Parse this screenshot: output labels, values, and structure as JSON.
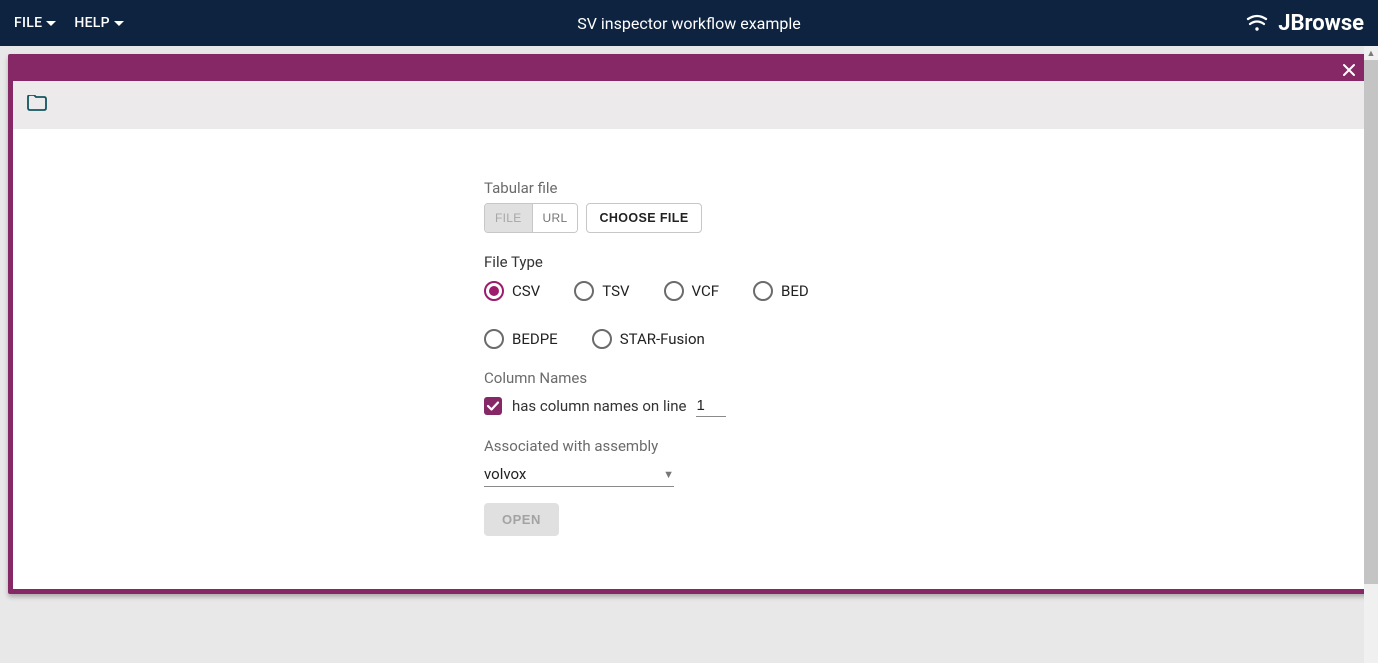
{
  "top": {
    "menu": {
      "file": "FILE",
      "help": "HELP"
    },
    "title": "SV inspector workflow example",
    "brand": "JBrowse"
  },
  "form": {
    "tabular_label": "Tabular file",
    "source_toggle": {
      "file": "FILE",
      "url": "URL"
    },
    "choose_file": "CHOOSE FILE",
    "file_type_label": "File Type",
    "file_types": {
      "csv": "CSV",
      "tsv": "TSV",
      "vcf": "VCF",
      "bed": "BED",
      "bedpe": "BEDPE",
      "starfusion": "STAR-Fusion"
    },
    "column_names_label": "Column Names",
    "has_column_names": "has column names on line",
    "line_number": "1",
    "assembly_label": "Associated with assembly",
    "assembly_value": "volvox",
    "open": "OPEN"
  }
}
